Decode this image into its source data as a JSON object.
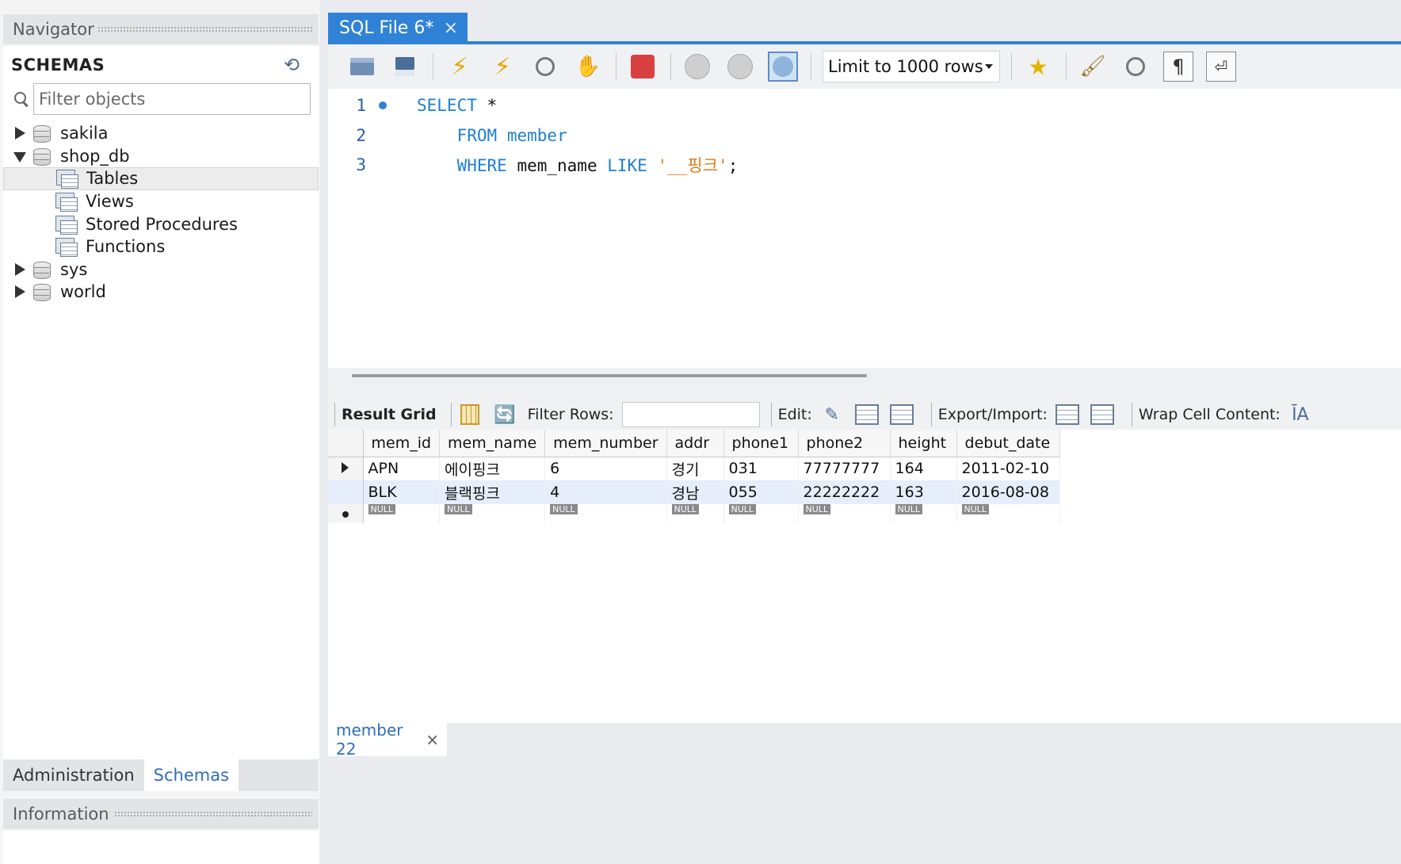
{
  "navigator": {
    "title": "Navigator",
    "schemas_title": "SCHEMAS",
    "filter_placeholder": "Filter objects",
    "tree": [
      {
        "label": "sakila",
        "kind": "db",
        "expanded": false
      },
      {
        "label": "shop_db",
        "kind": "db",
        "expanded": true
      },
      {
        "label": "Tables",
        "kind": "folder",
        "selected": true
      },
      {
        "label": "Views",
        "kind": "folder"
      },
      {
        "label": "Stored Procedures",
        "kind": "folder"
      },
      {
        "label": "Functions",
        "kind": "folder"
      },
      {
        "label": "sys",
        "kind": "db",
        "expanded": false
      },
      {
        "label": "world",
        "kind": "db",
        "expanded": false
      }
    ],
    "tabs": {
      "administration": "Administration",
      "schemas": "Schemas"
    },
    "info_title": "Information"
  },
  "editor_tab": {
    "label": "SQL File 6*",
    "close": "×"
  },
  "toolbar": {
    "limit_label": "Limit to 1000 rows"
  },
  "sql": {
    "lines": [
      {
        "num": "1",
        "parts": [
          [
            "kw",
            "SELECT"
          ],
          [
            "plain",
            " *"
          ]
        ]
      },
      {
        "num": "2",
        "parts": [
          [
            "plain",
            "    "
          ],
          [
            "kw",
            "FROM"
          ],
          [
            "plain",
            " "
          ],
          [
            "ident",
            "member"
          ]
        ]
      },
      {
        "num": "3",
        "parts": [
          [
            "plain",
            "    "
          ],
          [
            "kw",
            "WHERE"
          ],
          [
            "plain",
            " mem_name "
          ],
          [
            "kw",
            "LIKE"
          ],
          [
            "plain",
            " "
          ],
          [
            "str",
            "'__핑크'"
          ],
          [
            "plain",
            ";"
          ]
        ]
      }
    ]
  },
  "result_toolbar": {
    "result_grid": "Result Grid",
    "filter_rows": "Filter Rows:",
    "edit": "Edit:",
    "export_import": "Export/Import:",
    "wrap_cell": "Wrap Cell Content:"
  },
  "result": {
    "columns": [
      "mem_id",
      "mem_name",
      "mem_number",
      "addr",
      "phone1",
      "phone2",
      "height",
      "debut_date"
    ],
    "rows": [
      [
        "APN",
        "에이핑크",
        "6",
        "경기",
        "031",
        "77777777",
        "164",
        "2011-02-10"
      ],
      [
        "BLK",
        "블랙핑크",
        "4",
        "경남",
        "055",
        "22222222",
        "163",
        "2016-08-08"
      ]
    ],
    "null_label": "NULL"
  },
  "bottom_tab": {
    "label": "member 22",
    "close": "×"
  }
}
